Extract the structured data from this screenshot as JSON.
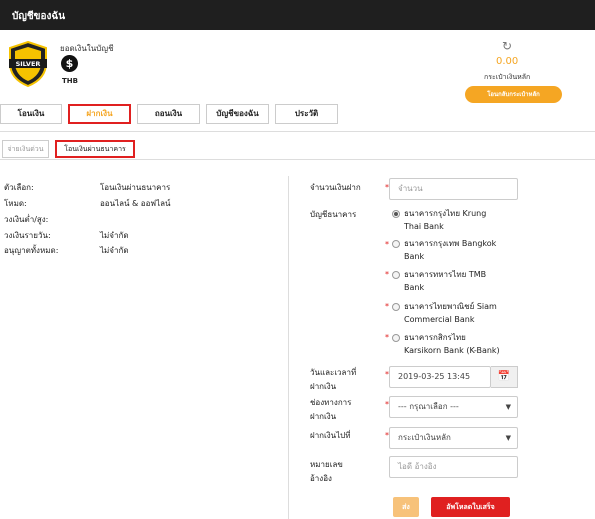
{
  "header": {
    "title": "บัญชีของฉัน"
  },
  "account": {
    "badge_icon": "silver-shield-icon",
    "badge_text": "SILVER",
    "balance_label": "ยอดเงินในบัญชี",
    "currency_icon": "dollar-coin-icon",
    "currency_symbol": "$",
    "currency_code": "THB"
  },
  "wallet": {
    "refresh_icon": "refresh-icon",
    "balance": "0.00",
    "label": "กระเป๋าเงินหลัก",
    "transfer_label": "โอนกลับกระเป๋าหลัก",
    "accent_color": "#f5a623"
  },
  "tabs": [
    {
      "label": "โอนเงิน"
    },
    {
      "label": "ฝากเงิน",
      "active": true
    },
    {
      "label": "ถอนเงิน"
    },
    {
      "label": "บัญชีของฉัน"
    },
    {
      "label": "ประวัติ"
    }
  ],
  "subtabs": [
    {
      "label": "จ่ายเงินด่วน"
    },
    {
      "label": "โอนเงินผ่านธนาคาร",
      "active": true
    }
  ],
  "info": [
    {
      "label": "ตัวเลือก:",
      "value": "โอนเงินผ่านธนาคาร"
    },
    {
      "label": "โหมด:",
      "value": "ออนไลน์ & ออฟไลน์"
    },
    {
      "label": "วงเงินต่ำ/สูง:",
      "value": ""
    },
    {
      "label": "วงเงินรายวัน:",
      "value": "ไม่จำกัด"
    },
    {
      "label": "อนุญาตทั้งหมด:",
      "value": "ไม่จำกัด"
    }
  ],
  "form": {
    "amount_label": "จำนวนเงินฝาก",
    "amount_placeholder": "จำนวน",
    "bank_label": "บัญชีธนาคาร",
    "banks": [
      {
        "line1": "ธนาคารกรุงไทย Krung",
        "line2": "Thai Bank",
        "checked": true
      },
      {
        "line1": "ธนาคารกรุงเทพ Bangkok",
        "line2": "Bank",
        "checked": false
      },
      {
        "line1": "ธนาคารทหารไทย TMB",
        "line2": "Bank",
        "checked": false
      },
      {
        "line1": "ธนาคารไทยพาณิชย์ Siam",
        "line2": "Commercial Bank",
        "checked": false
      },
      {
        "line1": "ธนาคารกสิกรไทย",
        "line2": "Karsikorn Bank (K-Bank)",
        "checked": false
      }
    ],
    "datetime_label_1": "วันและเวลาที่",
    "datetime_label_2": "ฝากเงิน",
    "datetime_value": "2019-03-25 13:45",
    "calendar_icon": "calendar-icon",
    "channel_label_1": "ช่องทางการ",
    "channel_label_2": "ฝากเงิน",
    "channel_value": "--- กรุณาเลือก ---",
    "target_label": "ฝากเงินไปที่",
    "target_value": "กระเป๋าเงินหลัก",
    "ref_label_1": "หมายเลข",
    "ref_label_2": "อ้างอิง",
    "ref_placeholder": "ไอดี อ้างอิง",
    "send_label": "ส่ง",
    "upload_label": "อัพโหลดใบเสร็จ",
    "required_mark": "*"
  }
}
